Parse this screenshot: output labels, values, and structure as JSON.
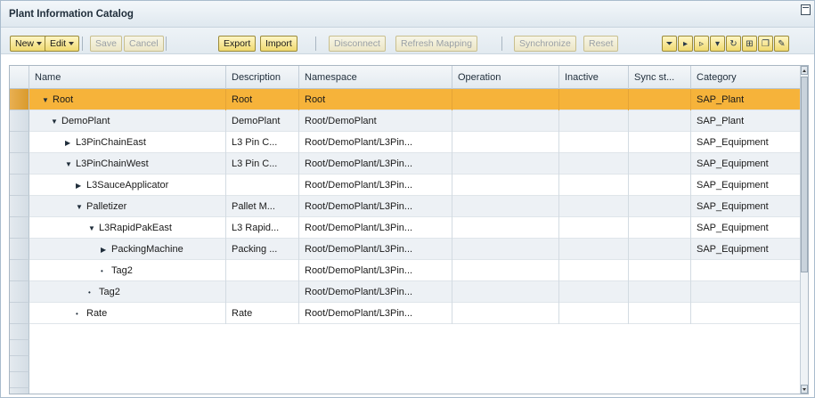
{
  "window": {
    "title": "Plant Information Catalog"
  },
  "toolbar": {
    "new_label": "New",
    "edit_label": "Edit",
    "save_label": "Save",
    "cancel_label": "Cancel",
    "export_label": "Export",
    "import_label": "Import",
    "disconnect_label": "Disconnect",
    "refresh_mapping_label": "Refresh Mapping",
    "synchronize_label": "Synchronize",
    "reset_label": "Reset",
    "icons": [
      "filter-icon",
      "expand-icon",
      "collapse-icon",
      "dropdown-icon",
      "refresh-icon",
      "settings-icon",
      "copy-icon",
      "tools-icon"
    ]
  },
  "table": {
    "columns": [
      "Name",
      "Description",
      "Namespace",
      "Operation",
      "Inactive",
      "Sync st...",
      "Category"
    ],
    "rows": [
      {
        "name": "Root",
        "toggle": "▼",
        "description": "Root",
        "namespace": "Root",
        "operation": "",
        "inactive": "",
        "sync": "",
        "category": "SAP_Plant",
        "selected": true
      },
      {
        "name": "DemoPlant",
        "toggle": "▼",
        "description": "DemoPlant",
        "namespace": "Root/DemoPlant",
        "operation": "",
        "inactive": "",
        "sync": "",
        "category": "SAP_Plant"
      },
      {
        "name": "L3PinChainEast",
        "toggle": "▶",
        "description": "L3 Pin C...",
        "namespace": "Root/DemoPlant/L3Pin...",
        "operation": "",
        "inactive": "",
        "sync": "",
        "category": "SAP_Equipment"
      },
      {
        "name": "L3PinChainWest",
        "toggle": "▼",
        "description": "L3 Pin C...",
        "namespace": "Root/DemoPlant/L3Pin...",
        "operation": "",
        "inactive": "",
        "sync": "",
        "category": "SAP_Equipment"
      },
      {
        "name": "L3SauceApplicator",
        "toggle": "▶",
        "description": "",
        "namespace": "Root/DemoPlant/L3Pin...",
        "operation": "",
        "inactive": "",
        "sync": "",
        "category": "SAP_Equipment"
      },
      {
        "name": "Palletizer",
        "toggle": "▼",
        "description": "Pallet M...",
        "namespace": "Root/DemoPlant/L3Pin...",
        "operation": "",
        "inactive": "",
        "sync": "",
        "category": "SAP_Equipment"
      },
      {
        "name": "L3RapidPakEast",
        "toggle": "▼",
        "description": "L3 Rapid...",
        "namespace": "Root/DemoPlant/L3Pin...",
        "operation": "",
        "inactive": "",
        "sync": "",
        "category": "SAP_Equipment"
      },
      {
        "name": "PackingMachine",
        "toggle": "▶",
        "description": "Packing ...",
        "namespace": "Root/DemoPlant/L3Pin...",
        "operation": "",
        "inactive": "",
        "sync": "",
        "category": "SAP_Equipment"
      },
      {
        "name": "Tag2",
        "toggle": "•",
        "description": "",
        "namespace": "Root/DemoPlant/L3Pin...",
        "operation": "",
        "inactive": "",
        "sync": "",
        "category": ""
      },
      {
        "name": "Tag2",
        "toggle": "•",
        "description": "",
        "namespace": "Root/DemoPlant/L3Pin...",
        "operation": "",
        "inactive": "",
        "sync": "",
        "category": ""
      },
      {
        "name": "Rate",
        "toggle": "•",
        "description": "Rate",
        "namespace": "Root/DemoPlant/L3Pin...",
        "operation": "",
        "inactive": "",
        "sync": "",
        "category": ""
      }
    ]
  }
}
